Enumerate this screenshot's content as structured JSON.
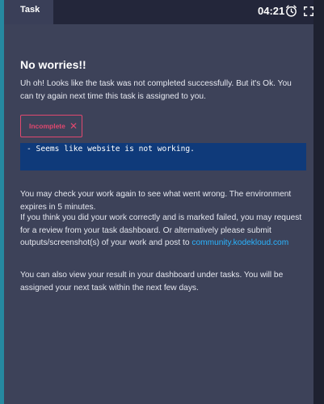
{
  "header": {
    "tab_label": "Task",
    "timer": "04:21"
  },
  "main": {
    "title": "No worries!!",
    "intro": "Uh oh! Looks like the task was not completed successfully. But it's Ok. You can try again next time this task is assigned to you.",
    "status_badge": "Incomplete",
    "console_output": "- Seems like website is not working.",
    "check_work": "You may check your work again to see what went wrong. The environment expires in 5 minutes.",
    "review_text": "If you think you did your work correctly and is marked failed, you may request for a review from your task dashboard. Or alternatively please submit outputs/screenshot(s) of your work and post to ",
    "community_link": "community.kodekloud.com",
    "dashboard_note": "You can also view your result in your dashboard under tasks. You will be assigned your next task within the next few days."
  },
  "colors": {
    "accent_link": "#2ab4ff",
    "status_incomplete": "#e0486f",
    "console_bg": "#0f3a7a",
    "panel_bg": "#3d4259"
  },
  "icons": [
    "alarm-clock-icon",
    "expand-icon",
    "close-icon"
  ]
}
